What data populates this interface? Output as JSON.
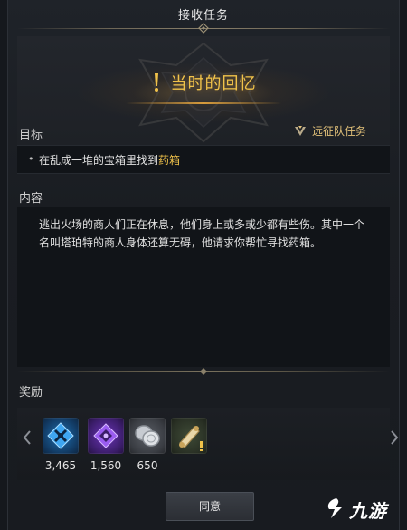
{
  "dialog": {
    "title": "接收任务"
  },
  "banner": {
    "quest_name": "当时的回忆",
    "exclaim_icon": "exclamation-icon"
  },
  "objective": {
    "heading": "目标",
    "quest_type": "远征队任务",
    "quest_type_icon": "expedition-emblem-icon",
    "bullet": "•",
    "text_before": "在乱成一堆的宝箱里找到",
    "text_highlight": "药箱"
  },
  "content": {
    "heading": "内容",
    "line1": "逃出火场的商人们正在休息，他们身上或多或少都有些伤。其中一个",
    "line2": "名叫塔珀特的商人身体还算无碍，他请求你帮忙寻找药箱。"
  },
  "rewards": {
    "heading": "奖励",
    "items": [
      {
        "icon": "blue-rune-icon",
        "qty": "3,465",
        "color": "#1e6fb0"
      },
      {
        "icon": "purple-gem-icon",
        "qty": "1,560",
        "color": "#6b34b8"
      },
      {
        "icon": "silver-coins-icon",
        "qty": "650",
        "color": "#9ea3aa"
      },
      {
        "icon": "scroll-icon",
        "qty": "",
        "color": "#c9a45a"
      }
    ]
  },
  "accept_button": {
    "label": "同意"
  },
  "watermark": {
    "text": "九游"
  },
  "colors": {
    "highlight": "#f0c24a",
    "expedition": "#e3c27a"
  }
}
